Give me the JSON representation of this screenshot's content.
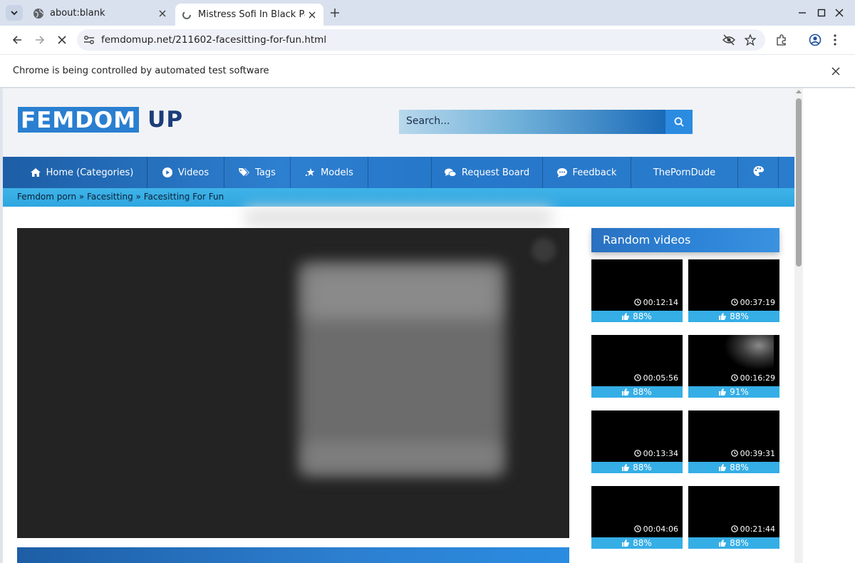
{
  "browser": {
    "tabs": [
      {
        "title": "about:blank",
        "active": false
      },
      {
        "title": "Mistress Sofi In Black Pan",
        "active": true
      }
    ],
    "url": "femdomup.net/211602-facesitting-for-fun.html",
    "infobar_message": "Chrome is being controlled by automated test software"
  },
  "site": {
    "logo_box": "FEMDOM",
    "logo_rest": "UP",
    "search_placeholder": "Search...",
    "nav": [
      {
        "label": "Home (Categories)",
        "icon": "home-icon"
      },
      {
        "label": "Videos",
        "icon": "play-icon"
      },
      {
        "label": "Tags",
        "icon": "tags-icon"
      },
      {
        "label": "Models",
        "icon": "star-icon"
      },
      {
        "label": "",
        "icon": ""
      },
      {
        "label": "Request Board",
        "icon": "comments-icon"
      },
      {
        "label": "Feedback",
        "icon": "comment-icon"
      },
      {
        "label": "ThePornDude",
        "icon": ""
      },
      {
        "label": "",
        "icon": "palette-icon"
      }
    ],
    "breadcrumb": "Femdom porn » Facesitting » Facesitting For Fun",
    "sidebar_title": "Random videos",
    "videos": [
      {
        "duration": "00:12:14",
        "rating": "88%"
      },
      {
        "duration": "00:37:19",
        "rating": "88%"
      },
      {
        "duration": "00:05:56",
        "rating": "88%"
      },
      {
        "duration": "00:16:29",
        "rating": "91%"
      },
      {
        "duration": "00:13:34",
        "rating": "88%"
      },
      {
        "duration": "00:39:31",
        "rating": "88%"
      },
      {
        "duration": "00:04:06",
        "rating": "88%"
      },
      {
        "duration": "00:21:44",
        "rating": "88%"
      }
    ]
  }
}
